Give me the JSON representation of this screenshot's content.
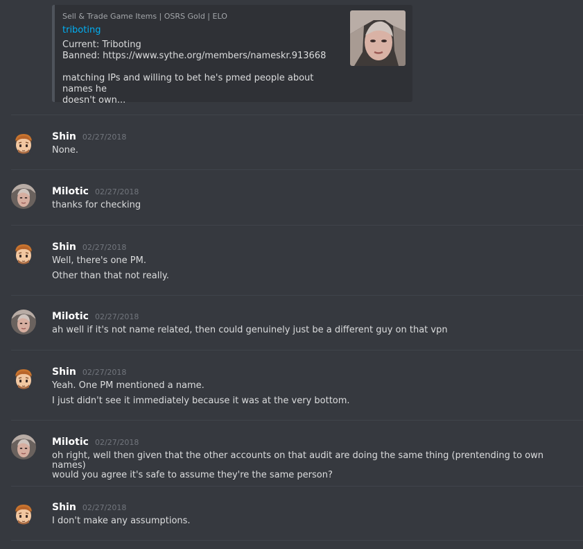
{
  "embed": {
    "provider": "Sell & Trade Game Items | OSRS Gold | ELO",
    "author": "triboting",
    "description_lines": [
      "Current: Triboting",
      "Banned: https://www.sythe.org/members/nameskr.913668",
      "",
      "matching IPs and willing to bet he's pmed people about names he",
      "doesn't own..."
    ]
  },
  "messages": [
    {
      "username": "Shin",
      "timestamp": "02/27/2018",
      "avatar": "cartoon-avatar-icon",
      "lines": [
        "None."
      ]
    },
    {
      "username": "Milotic",
      "timestamp": "02/27/2018",
      "avatar": "photo-avatar-icon",
      "lines": [
        "thanks for checking"
      ]
    },
    {
      "username": "Shin",
      "timestamp": "02/27/2018",
      "avatar": "cartoon-avatar-icon",
      "lines": [
        "Well, there's one PM.",
        "Other than that not really."
      ]
    },
    {
      "username": "Milotic",
      "timestamp": "02/27/2018",
      "avatar": "photo-avatar-icon",
      "lines": [
        "ah well if it's not name related, then could genuinely just be a different guy on that vpn"
      ]
    },
    {
      "username": "Shin",
      "timestamp": "02/27/2018",
      "avatar": "cartoon-avatar-icon",
      "lines": [
        "Yeah. One PM mentioned a name.",
        "I just didn't see it immediately because it was at the very bottom."
      ]
    },
    {
      "username": "Milotic",
      "timestamp": "02/27/2018",
      "avatar": "photo-avatar-icon",
      "lines": [
        "oh right, well then given that the other accounts on that audit are doing the same thing (prentending to own names)",
        "would you agree it's safe to assume they're the same person?"
      ]
    },
    {
      "username": "Shin",
      "timestamp": "02/27/2018",
      "avatar": "cartoon-avatar-icon",
      "lines": [
        "I don't make any assumptions."
      ]
    }
  ],
  "colors": {
    "background": "#36393f",
    "embed_bg": "#2f3136",
    "link": "#00b0f4",
    "username": "#ffffff",
    "timestamp": "#72767d",
    "text": "#dcddde"
  }
}
